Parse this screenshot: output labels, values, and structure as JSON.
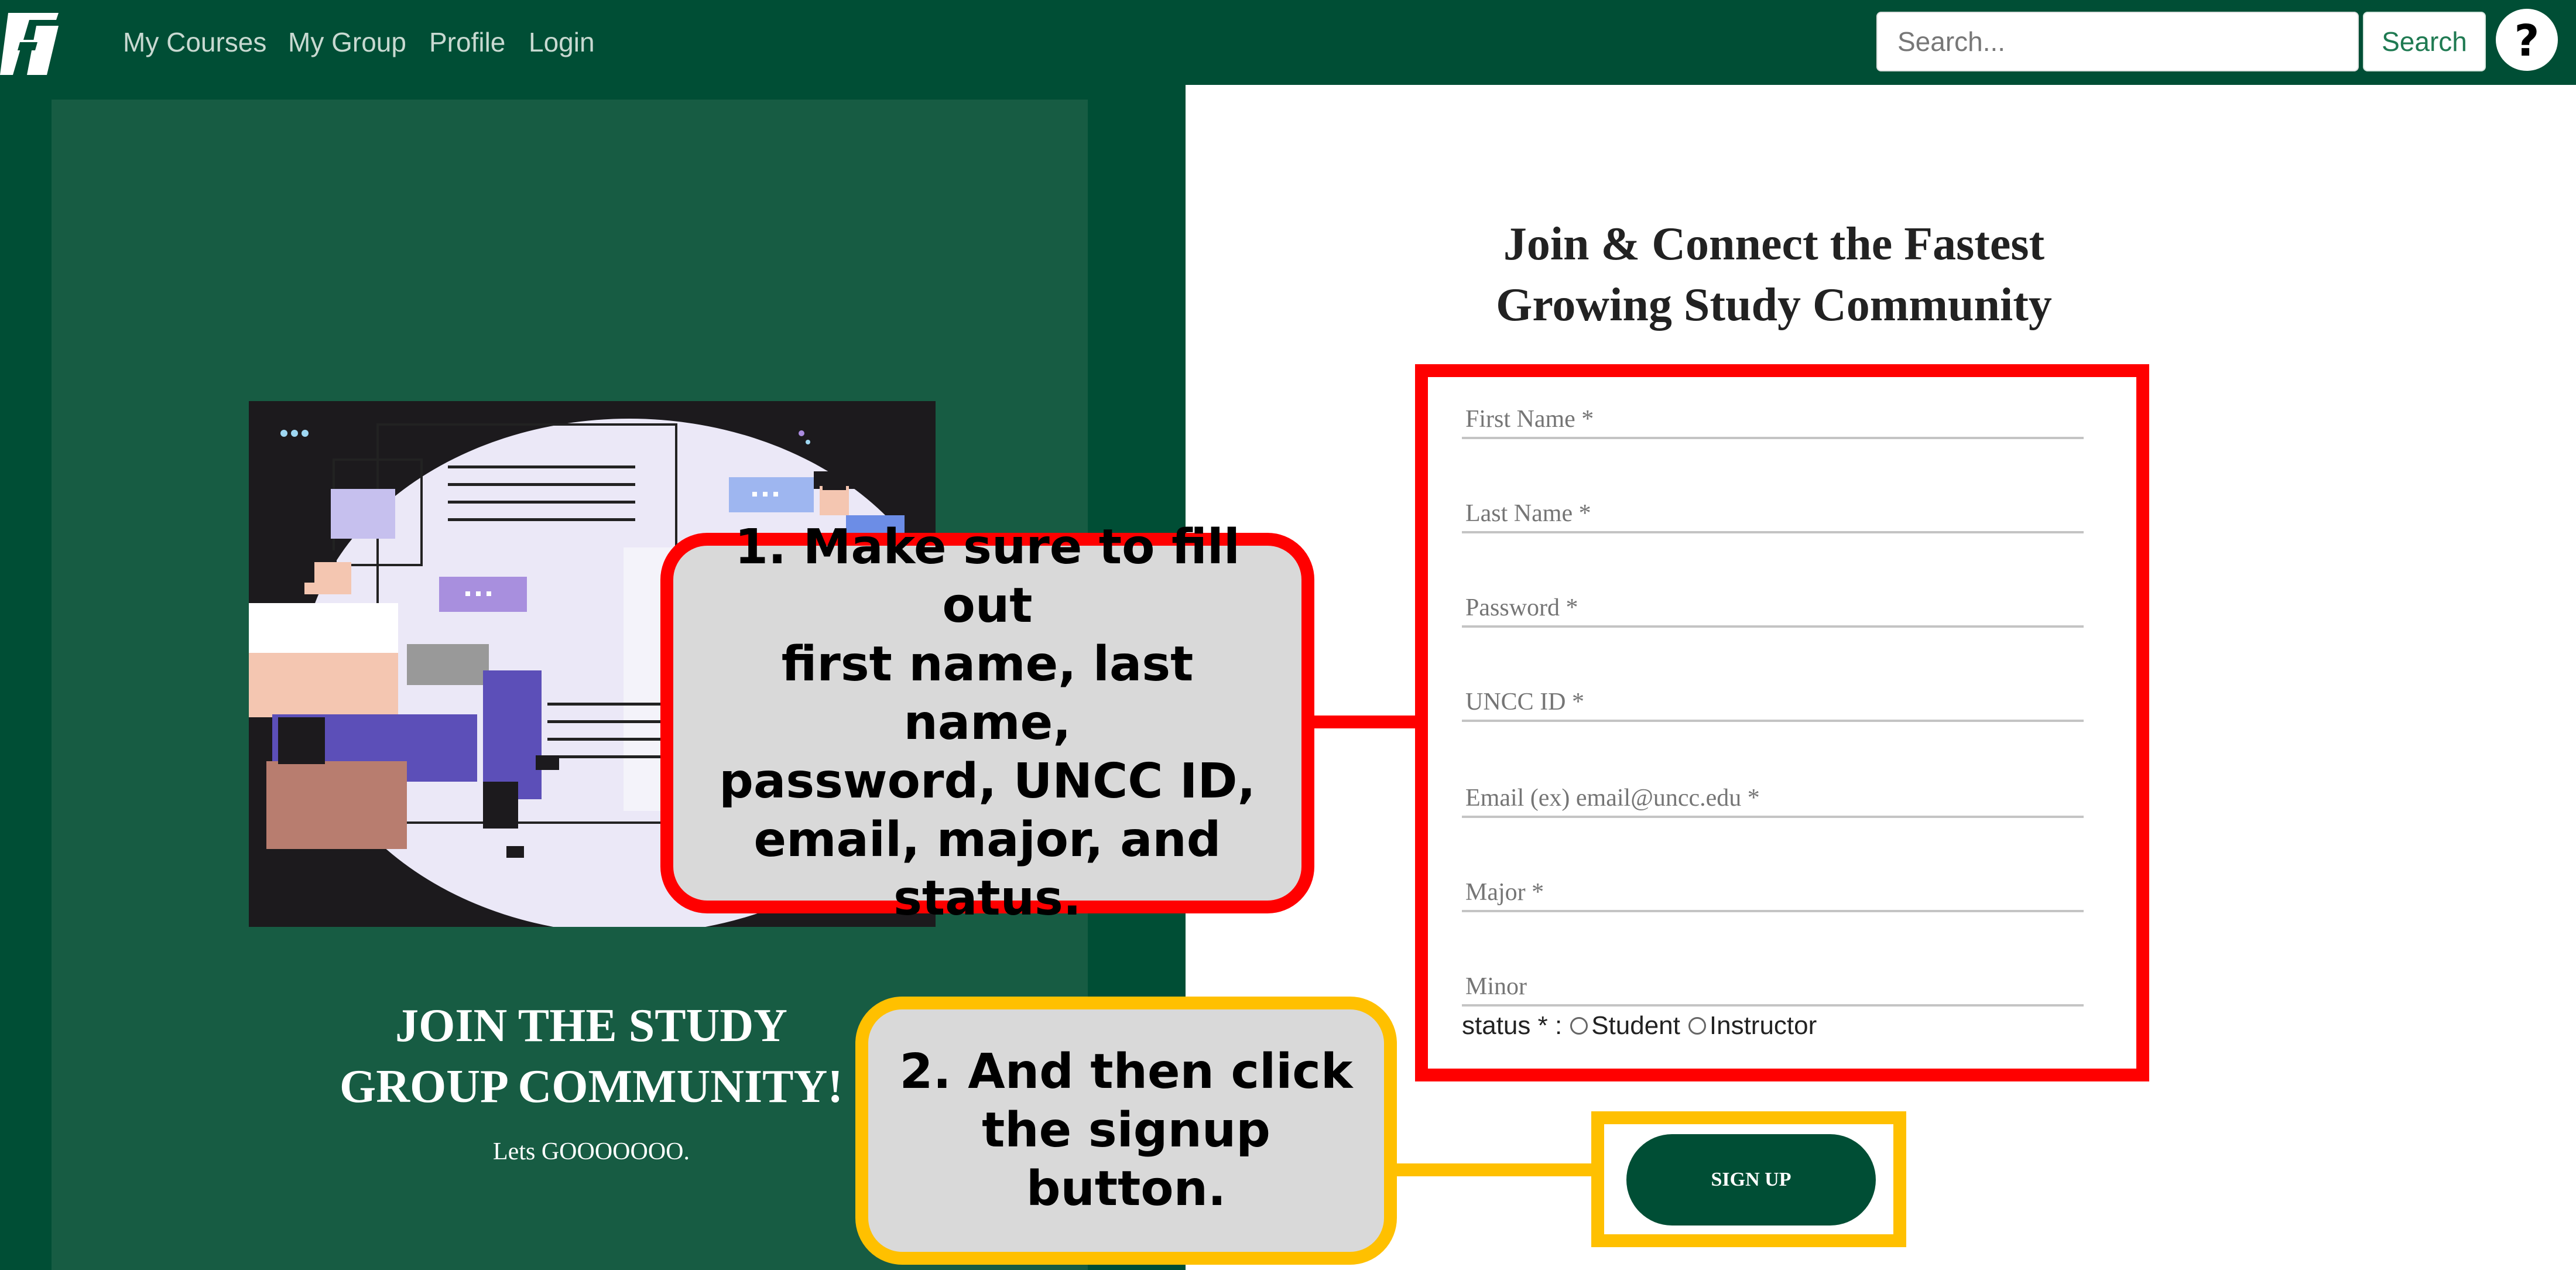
{
  "nav": {
    "links": [
      "My Courses",
      "My Group",
      "Profile",
      "Login"
    ],
    "search_placeholder": "Search...",
    "search_button": "Search",
    "help_label": "?"
  },
  "left_panel": {
    "heading_line1": "JOIN THE STUDY",
    "heading_line2": "GROUP COMMUNITY!",
    "subtext": "Lets GOOOOOOO."
  },
  "form": {
    "title_line1": "Join & Connect the Fastest",
    "title_line2": "Growing Study Community",
    "fields": {
      "first_name": "First Name *",
      "last_name": "Last Name *",
      "password": "Password *",
      "uncc_id": "UNCC ID *",
      "email": "Email (ex) email@uncc.edu *",
      "major": "Major *",
      "minor": "Minor"
    },
    "status_label": "status * :",
    "status_options": [
      "Student",
      "Instructor"
    ],
    "signup_button": "SIGN UP"
  },
  "callouts": {
    "step1_lines": [
      "1. Make sure to fill out",
      "first name, last name,",
      "password, UNCC ID,",
      "email, major, and status."
    ],
    "step2_lines": [
      "2. And then click",
      "the signup button."
    ]
  },
  "colors": {
    "brand_green": "#004e35",
    "panel_green": "#175c43",
    "highlight_red": "#ff0000",
    "highlight_yellow": "#ffc000",
    "callout_fill": "#d9d9d9"
  }
}
